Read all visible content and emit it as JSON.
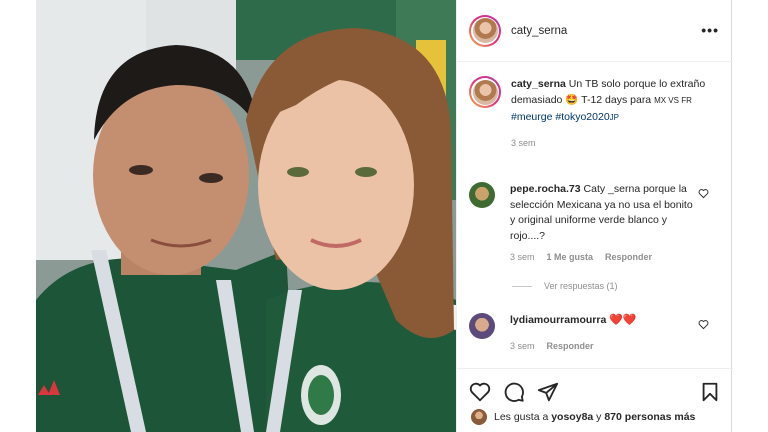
{
  "post": {
    "username": "caty_serna",
    "more_label": "•••"
  },
  "caption": {
    "username": "caty_serna",
    "text_before": "Un TB solo porque lo extraño demasiado",
    "emoji": "🤩",
    "text_after": "T-12 days para",
    "mx_vs_fr": "MX VS FR",
    "hashtag1": "#meurge",
    "hashtag2": "#tokyo2020",
    "hashtag2_suffix": "JP",
    "time": "3 sem"
  },
  "comments": [
    {
      "username": "pepe.rocha.73",
      "text": "Caty _serna porque la selección Mexicana ya no usa el bonito y original uniforme verde blanco y rojo....?",
      "time": "3 sem",
      "likes": "1 Me gusta",
      "reply": "Responder",
      "view_replies": "Ver respuestas (1)"
    },
    {
      "username": "lydiamourramourra",
      "hearts": "❤️❤️",
      "time": "3 sem",
      "reply": "Responder"
    }
  ],
  "likes": {
    "prefix": "Les gusta a",
    "user": "yosoy8a",
    "middle": "y",
    "count": "870 personas más"
  },
  "icons": {
    "like": "heart-icon",
    "comment": "comment-icon",
    "share": "send-icon",
    "save": "bookmark-icon"
  },
  "colors": {
    "jersey_green": "#1d5a3c",
    "link_blue": "#00376b",
    "muted_gray": "#8e8e8e",
    "heart_red": "#ed4956"
  }
}
